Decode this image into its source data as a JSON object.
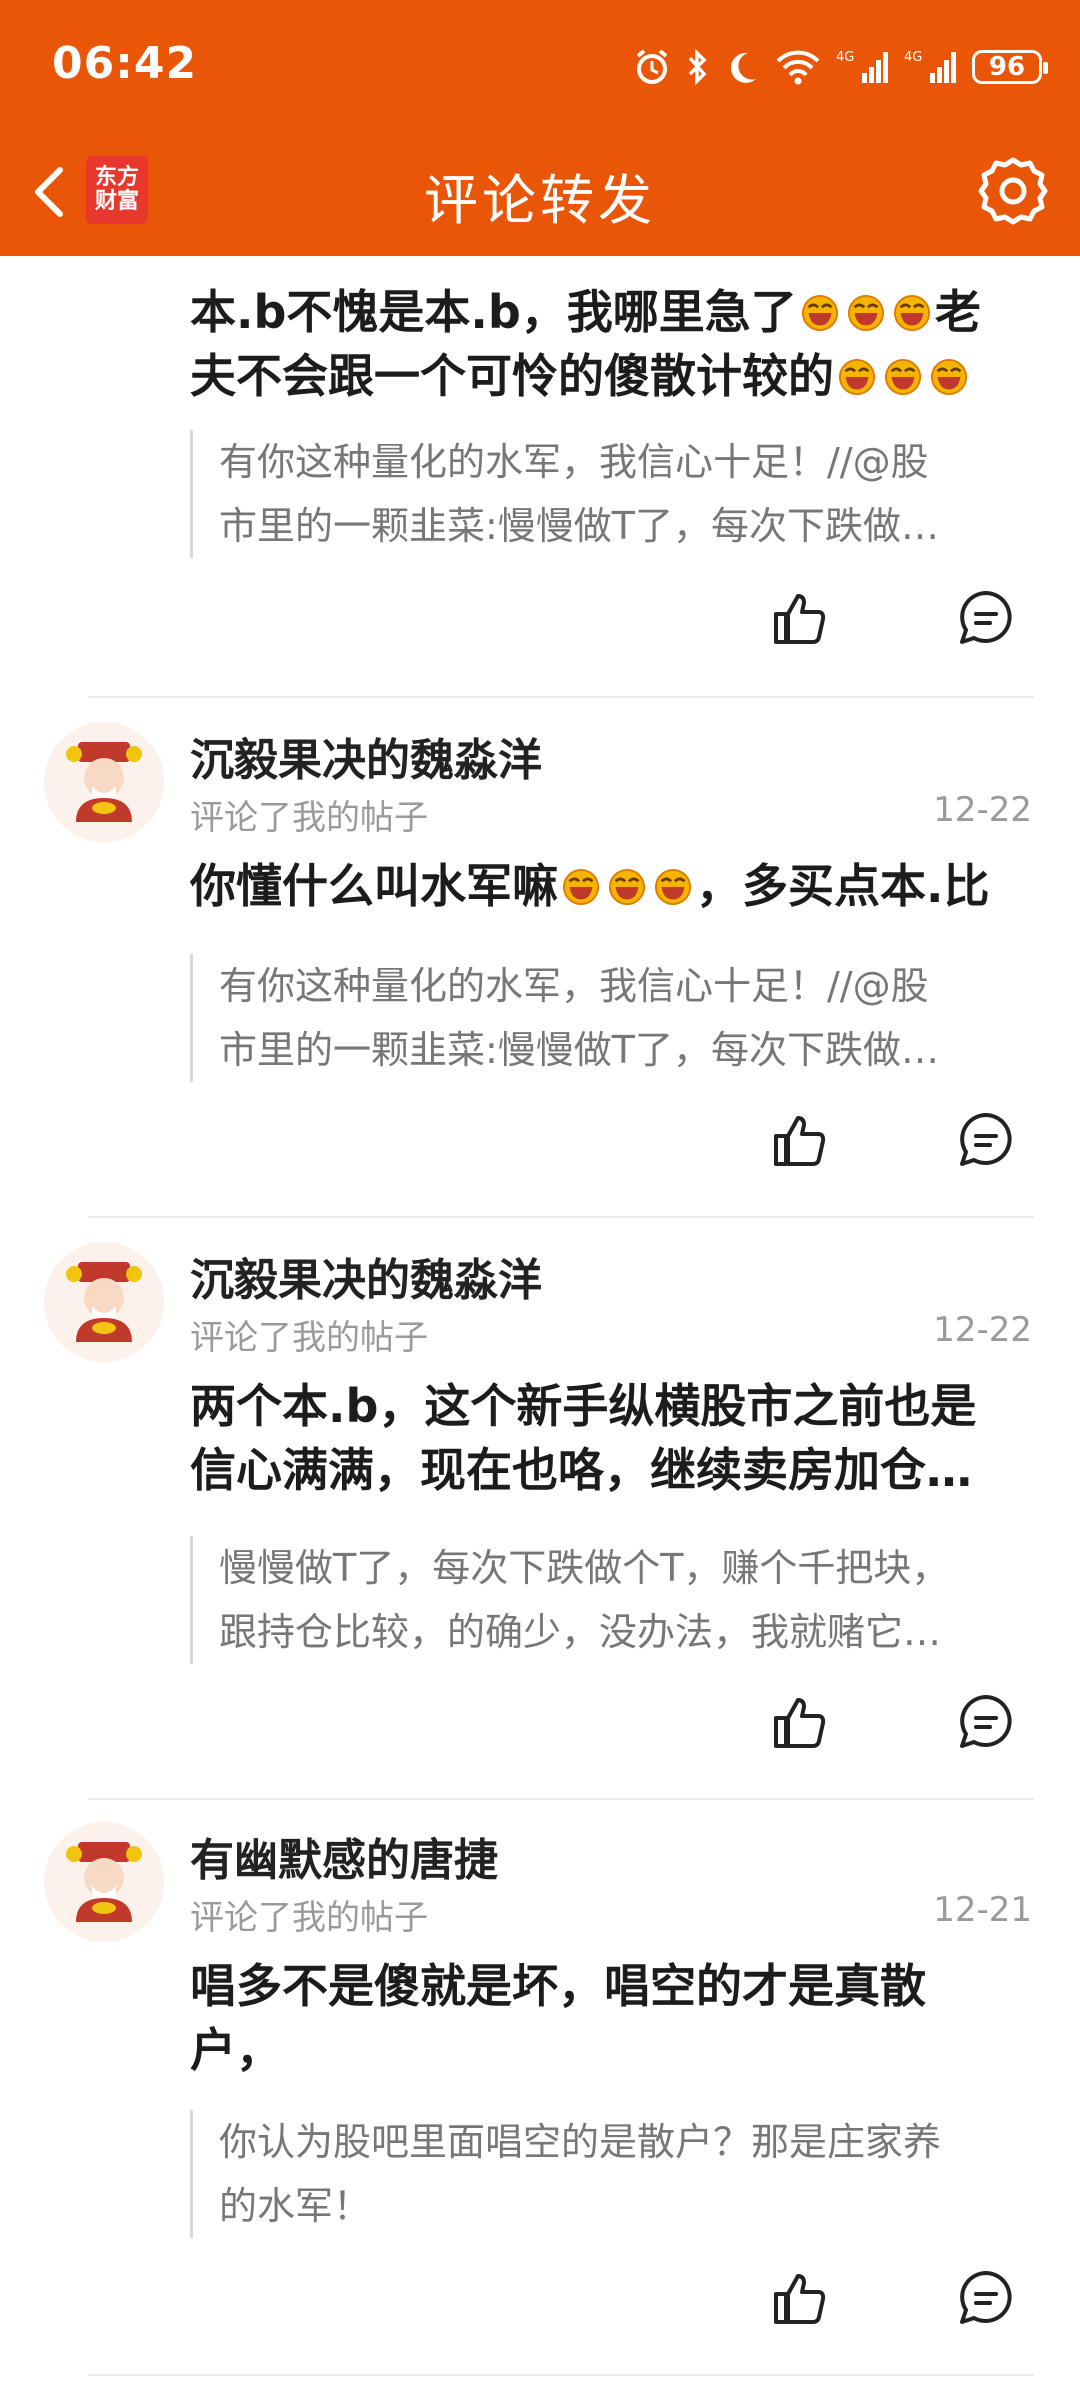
{
  "status_bar": {
    "time": "06:42",
    "battery": "96"
  },
  "nav": {
    "title": "评论转发",
    "logo_line1": "东方",
    "logo_line2": "财富"
  },
  "items": [
    {
      "comment_a": "本.b不愧是本.b，我哪里急了",
      "comment_b": "老",
      "comment_c": "夫不会跟一个可怜的傻散计较的",
      "quote_1": "有你这种量化的水军，我信心十足！//@股",
      "quote_2": "市里的一颗韭菜:慢慢做T了，每次下跌做…"
    },
    {
      "username": "沉毅果决的魏淼洋",
      "subline": "评论了我的帖子",
      "date": "12-22",
      "comment_a": "你懂什么叫水军嘛",
      "comment_b": "，多买点本.比",
      "quote_1": "有你这种量化的水军，我信心十足！//@股",
      "quote_2": "市里的一颗韭菜:慢慢做T了，每次下跌做…"
    },
    {
      "username": "沉毅果决的魏淼洋",
      "subline": "评论了我的帖子",
      "date": "12-22",
      "comment_1": "两个本.b，这个新手纵横股市之前也是",
      "comment_2": "信心满满，现在也咯，继续卖房加仓…",
      "quote_1": "慢慢做T了，每次下跌做个T，赚个千把块，",
      "quote_2": "跟持仓比较，的确少，没办法，我就赌它…"
    },
    {
      "username": "有幽默感的唐捷",
      "subline": "评论了我的帖子",
      "date": "12-21",
      "comment_1": "唱多不是傻就是坏，唱空的才是真散",
      "comment_2": "户，",
      "quote_1": "你认为股吧里面唱空的是散户？那是庄家养",
      "quote_2": "的水军！"
    }
  ],
  "colors": {
    "brand": "#E95608",
    "muted": "#9a9a9a"
  },
  "icons": [
    "back-arrow-icon",
    "gear-icon",
    "thumbs-up-icon",
    "comment-icon",
    "laugh-emoji-icon",
    "alarm-icon",
    "bluetooth-icon",
    "moon-icon",
    "wifi-icon",
    "signal-icon"
  ]
}
